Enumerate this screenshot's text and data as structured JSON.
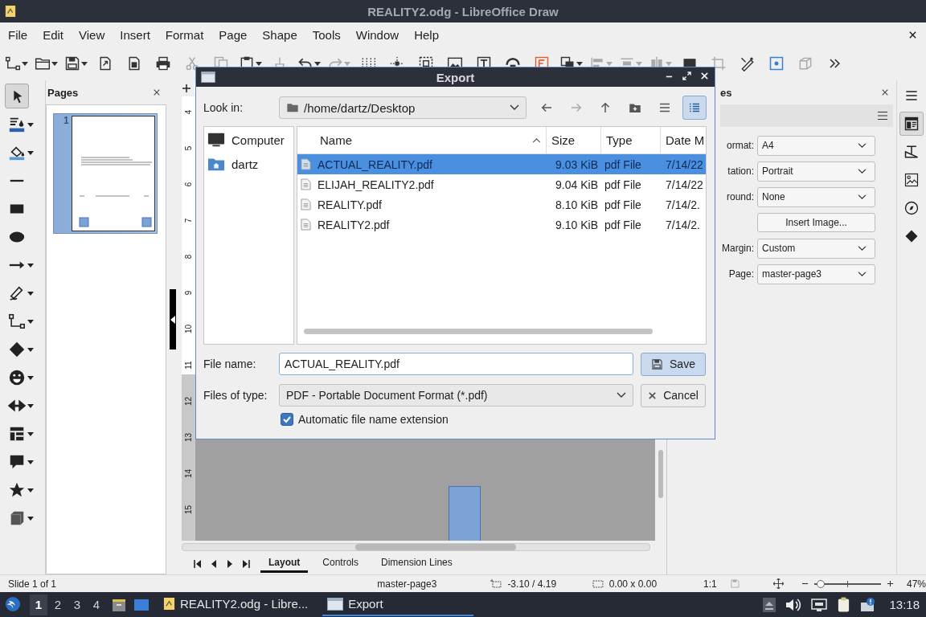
{
  "window": {
    "title": "REALITY2.odg - LibreOffice Draw"
  },
  "menu": [
    "File",
    "Edit",
    "View",
    "Insert",
    "Format",
    "Page",
    "Shape",
    "Tools",
    "Window",
    "Help"
  ],
  "toolbar": [
    {
      "kind": "connector",
      "menu": true,
      "disabled": false
    },
    {
      "kind": "open",
      "menu": true,
      "disabled": false
    },
    {
      "kind": "save",
      "menu": true,
      "disabled": false
    },
    {
      "kind": "export",
      "menu": false,
      "disabled": false
    },
    {
      "kind": "pdf",
      "menu": false,
      "disabled": false
    },
    {
      "kind": "print",
      "menu": false,
      "disabled": false
    },
    {
      "kind": "cut",
      "menu": false,
      "disabled": true
    },
    {
      "kind": "copy",
      "menu": false,
      "disabled": true
    },
    {
      "kind": "paste",
      "menu": true,
      "disabled": false
    },
    {
      "kind": "clone",
      "menu": false,
      "disabled": true
    },
    {
      "kind": "undo",
      "menu": true,
      "disabled": false
    },
    {
      "kind": "redo",
      "menu": true,
      "disabled": true
    },
    {
      "kind": "grid",
      "menu": false,
      "disabled": false
    },
    {
      "kind": "helplines",
      "menu": false,
      "disabled": false
    },
    {
      "kind": "zoom",
      "menu": false,
      "disabled": false
    },
    {
      "kind": "image",
      "menu": false,
      "disabled": false
    },
    {
      "kind": "textbox",
      "menu": false,
      "disabled": false
    },
    {
      "kind": "fontwork",
      "menu": false,
      "disabled": false
    },
    {
      "kind": "charmap",
      "menu": false,
      "disabled": false
    },
    {
      "kind": "transform",
      "menu": true,
      "disabled": false
    },
    {
      "kind": "align",
      "menu": true,
      "disabled": true
    },
    {
      "kind": "arrange",
      "menu": true,
      "disabled": true
    },
    {
      "kind": "distribute",
      "menu": true,
      "disabled": true
    },
    {
      "kind": "shadow",
      "menu": false,
      "disabled": false
    },
    {
      "kind": "crop",
      "menu": false,
      "disabled": true
    },
    {
      "kind": "points",
      "menu": false,
      "disabled": false
    },
    {
      "kind": "glue",
      "menu": false,
      "disabled": false
    },
    {
      "kind": "extrusion",
      "menu": false,
      "disabled": true
    },
    {
      "kind": "more",
      "menu": false,
      "disabled": false
    }
  ],
  "draw_toolbar": [
    {
      "kind": "select",
      "menu": false,
      "selected": true
    },
    {
      "kind": "line-color",
      "menu": true,
      "selected": false
    },
    {
      "kind": "fill-color",
      "menu": true,
      "selected": false
    },
    {
      "kind": "line",
      "menu": false,
      "selected": false
    },
    {
      "kind": "rectangle",
      "menu": false,
      "selected": false
    },
    {
      "kind": "ellipse",
      "menu": false,
      "selected": false
    },
    {
      "kind": "arrow",
      "menu": true,
      "selected": false
    },
    {
      "kind": "curve",
      "menu": true,
      "selected": false
    },
    {
      "kind": "connector",
      "menu": true,
      "selected": false
    },
    {
      "kind": "diamond",
      "menu": true,
      "selected": false
    },
    {
      "kind": "smiley",
      "menu": true,
      "selected": false
    },
    {
      "kind": "double-arrow",
      "menu": true,
      "selected": false
    },
    {
      "kind": "flowchart",
      "menu": true,
      "selected": false
    },
    {
      "kind": "callout",
      "menu": true,
      "selected": false
    },
    {
      "kind": "star",
      "menu": true,
      "selected": false
    },
    {
      "kind": "cube",
      "menu": true,
      "selected": false
    }
  ],
  "pages_panel": {
    "title": "Pages",
    "thumbnails": [
      {
        "number": "1",
        "selected": true
      }
    ]
  },
  "ruler": {
    "marks": [
      "4",
      "5",
      "6",
      "7",
      "8",
      "9",
      "10",
      "11",
      "12",
      "13",
      "14",
      "15"
    ]
  },
  "sheet_tabs": [
    {
      "label": "Layout",
      "selected": true
    },
    {
      "label": "Controls",
      "selected": false
    },
    {
      "label": "Dimension Lines",
      "selected": false
    }
  ],
  "properties_panel": {
    "title": "es",
    "fields": [
      {
        "kind": "dropdown",
        "label": "ormat:",
        "value": "A4"
      },
      {
        "kind": "dropdown",
        "label": "tation:",
        "value": "Portrait"
      },
      {
        "kind": "dropdown",
        "label": "round:",
        "value": "None"
      },
      {
        "kind": "button",
        "value": "Insert Image..."
      },
      {
        "kind": "dropdown",
        "label": "Margin:",
        "value": "Custom"
      },
      {
        "kind": "dropdown",
        "label": "Page:",
        "value": "master-page3"
      }
    ]
  },
  "sidebar_tabs": [
    {
      "kind": "menu",
      "selected": false
    },
    {
      "kind": "properties",
      "selected": true
    },
    {
      "kind": "styles",
      "selected": false
    },
    {
      "kind": "gallery",
      "selected": false
    },
    {
      "kind": "navigator",
      "selected": false
    },
    {
      "kind": "shapes",
      "selected": false
    }
  ],
  "status_bar": {
    "slide": "Slide 1 of 1",
    "master": "master-page3",
    "position": "-3.10 / 4.19",
    "size": "0.00 x 0.00",
    "scale": "1:1",
    "zoom_slider": {
      "level": 0.1
    },
    "zoom": "47%"
  },
  "taskbar": {
    "workspaces": [
      {
        "label": "1",
        "selected": true
      },
      {
        "label": "2",
        "selected": false
      },
      {
        "label": "3",
        "selected": false
      },
      {
        "label": "4",
        "selected": false
      }
    ],
    "tasks": [
      {
        "label": "REALITY2.odg - Libre...",
        "kind": "draw",
        "selected": false
      },
      {
        "label": "Export",
        "kind": "dialog",
        "selected": true
      }
    ],
    "clock": "13:18"
  },
  "dialog": {
    "title": "Export",
    "look_in_label": "Look in:",
    "path": "/home/dartz/Desktop",
    "nav_buttons": [
      {
        "kind": "back",
        "disabled": false
      },
      {
        "kind": "forward",
        "disabled": true
      },
      {
        "kind": "up",
        "disabled": false
      },
      {
        "kind": "new-folder",
        "disabled": false
      }
    ],
    "view_modes": [
      {
        "kind": "list",
        "selected": false
      },
      {
        "kind": "detail",
        "selected": true
      }
    ],
    "places": [
      {
        "label": "Computer",
        "kind": "computer"
      },
      {
        "label": "dartz",
        "kind": "home"
      }
    ],
    "columns": [
      "Name",
      "Size",
      "Type",
      "Date M"
    ],
    "files": [
      {
        "name": "ACTUAL_REALITY.pdf",
        "size": "9.03 KiB",
        "type": "pdf File",
        "date": "7/14/22",
        "selected": true
      },
      {
        "name": "ELIJAH_REALITY2.pdf",
        "size": "9.04 KiB",
        "type": "pdf File",
        "date": "7/14/22",
        "selected": false
      },
      {
        "name": "REALITY.pdf",
        "size": "8.10 KiB",
        "type": "pdf File",
        "date": "7/14/2.",
        "selected": false
      },
      {
        "name": "REALITY2.pdf",
        "size": "9.10 KiB",
        "type": "pdf File",
        "date": "7/14/2.",
        "selected": false
      }
    ],
    "file_name_label": "File name:",
    "file_name": "ACTUAL_REALITY.pdf",
    "save": "Save",
    "type_label": "Files of type:",
    "file_type": "PDF - Portable Document Format (*.pdf)",
    "cancel": "Cancel",
    "auto_extension": {
      "label": "Automatic file name extension",
      "checked": true
    }
  }
}
